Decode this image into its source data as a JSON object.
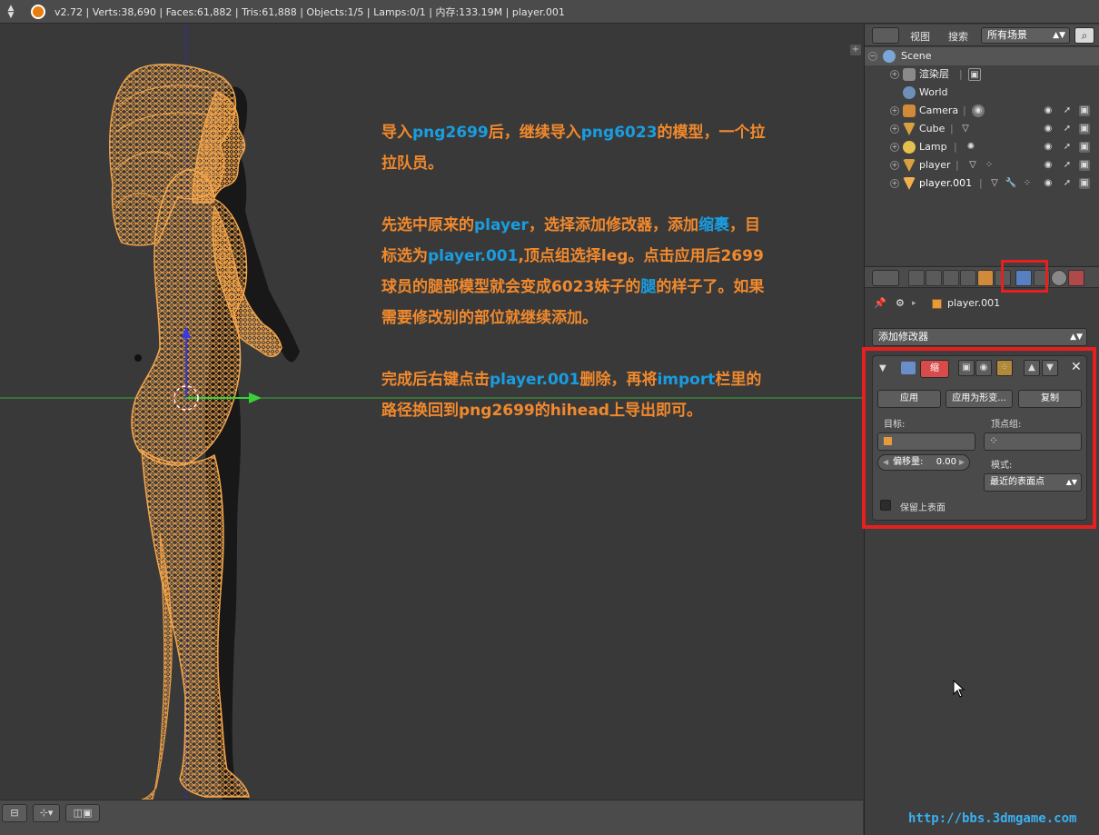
{
  "topbar": {
    "stats": "v2.72 | Verts:38,690 | Faces:61,882 | Tris:61,888 | Objects:1/5 | Lamps:0/1 | 内存:133.19M | player.001"
  },
  "instructions": {
    "p1": [
      {
        "t": "导入",
        "hl": false
      },
      {
        "t": "png2699",
        "hl": true
      },
      {
        "t": "后，继续导入",
        "hl": false
      },
      {
        "t": "png6023",
        "hl": true
      },
      {
        "t": "的模型，一个拉拉队员。",
        "hl": false
      }
    ],
    "p2": [
      {
        "t": "先选中原来的",
        "hl": false
      },
      {
        "t": "player",
        "hl": true
      },
      {
        "t": "，选择添加修改器，添加",
        "hl": false
      },
      {
        "t": "缩裹",
        "hl": true
      },
      {
        "t": "，目标选为",
        "hl": false
      },
      {
        "t": "player.001",
        "hl": true
      },
      {
        "t": ",顶点组选择leg。点击应用后2699球员的腿部模型就会变成6023妹子的",
        "hl": false
      },
      {
        "t": "腿",
        "hl": true
      },
      {
        "t": "的样子了。如果需要修改别的部位就继续添加。",
        "hl": false
      }
    ],
    "p3": [
      {
        "t": "完成后右键点击",
        "hl": false
      },
      {
        "t": "player.001",
        "hl": true
      },
      {
        "t": "删除，再将",
        "hl": false
      },
      {
        "t": "import",
        "hl": true
      },
      {
        "t": "栏里的路径换回到png2699的hihead上导出即可。",
        "hl": false
      }
    ]
  },
  "outliner_header": {
    "menu_view": "视图",
    "menu_search": "搜索",
    "scene_filter": "所有场景"
  },
  "outliner": {
    "scene": "Scene",
    "render_layers": "渲染层",
    "world": "World",
    "camera": "Camera",
    "cube": "Cube",
    "lamp": "Lamp",
    "player": "player",
    "player001": "player.001"
  },
  "properties": {
    "breadcrumb_object": "player.001",
    "add_modifier": "添加修改器",
    "modifier_name": "缩",
    "apply": "应用",
    "apply_shape": "应用为形变...",
    "copy": "复制",
    "target_label": "目标:",
    "vertex_group_label": "顶点组:",
    "offset_label": "偏移量:",
    "offset_value": "0.00",
    "mode_label": "模式:",
    "mode_value": "最近的表面点",
    "keep_above": "保留上表面"
  },
  "watermark": "http://bbs.3dmgame.com",
  "colors": {
    "instruction_text": "#f1892d",
    "instruction_highlight": "#1a9de0",
    "wireframe": "#f5a54a",
    "highlight_box": "#e62020",
    "active_tab": "#5680c2"
  },
  "icons": {
    "modifier_tab": "wrench-icon",
    "search": "magnifier-icon",
    "visibility": "eye-icon",
    "selectability": "cursor-icon",
    "renderability": "camera-icon"
  }
}
